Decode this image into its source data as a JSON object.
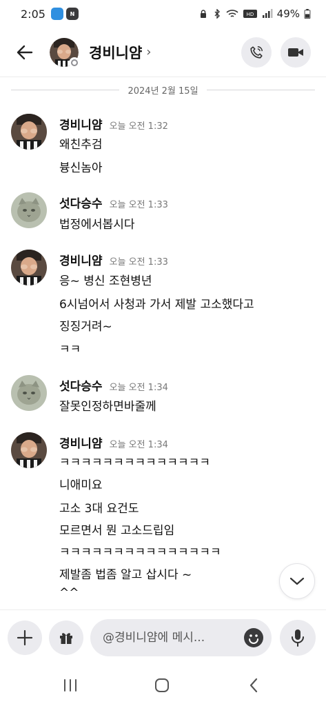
{
  "status_bar": {
    "time": "2:05",
    "battery": "49%",
    "app_badges": [
      "blue-app-badge",
      "n-app-badge"
    ]
  },
  "header": {
    "title": "경비니얌",
    "title_chevron": "›",
    "call_icon": "phone-icon",
    "video_icon": "video-camera-icon"
  },
  "date_divider": "2024년 2월 15일",
  "messages": [
    {
      "name": "경비니얌",
      "time": "오늘 오전 1:32",
      "avatar": "person-avatar",
      "lines": [
        "왜친추검",
        "븅신놈아"
      ]
    },
    {
      "name": "섯다승수",
      "time": "오늘 오전 1:33",
      "avatar": "cat-avatar",
      "lines": [
        "법정에서봅시다"
      ]
    },
    {
      "name": "경비니얌",
      "time": "오늘 오전 1:33",
      "avatar": "person-avatar",
      "lines": [
        "응~ 병신 조현병년",
        "6시넘어서 사청과 가서 제발 고소했다고",
        "징징거려~",
        "ㅋㅋ"
      ]
    },
    {
      "name": "섯다승수",
      "time": "오늘 오전 1:34",
      "avatar": "cat-avatar",
      "lines": [
        "잘못인정하면바줄께"
      ]
    },
    {
      "name": "경비니얌",
      "time": "오늘 오전 1:34",
      "avatar": "person-avatar",
      "lines": [
        "ㅋㅋㅋㅋㅋㅋㅋㅋㅋㅋㅋㅋㅋㅋ",
        "니애미요",
        "고소 3대 요건도",
        "모르면서 뭔 고소드립임",
        "ㅋㅋㅋㅋㅋㅋㅋㅋㅋㅋㅋㅋㅋㅋㅋ",
        "제발좀 법좀 알고 삽시다 ~",
        "^^"
      ]
    }
  ],
  "input": {
    "placeholder": "@경비니얌에 메시..."
  },
  "colors": {
    "button_bg": "#ebebef",
    "text": "#111111",
    "muted": "#777777",
    "divider": "#d5d5d8"
  }
}
